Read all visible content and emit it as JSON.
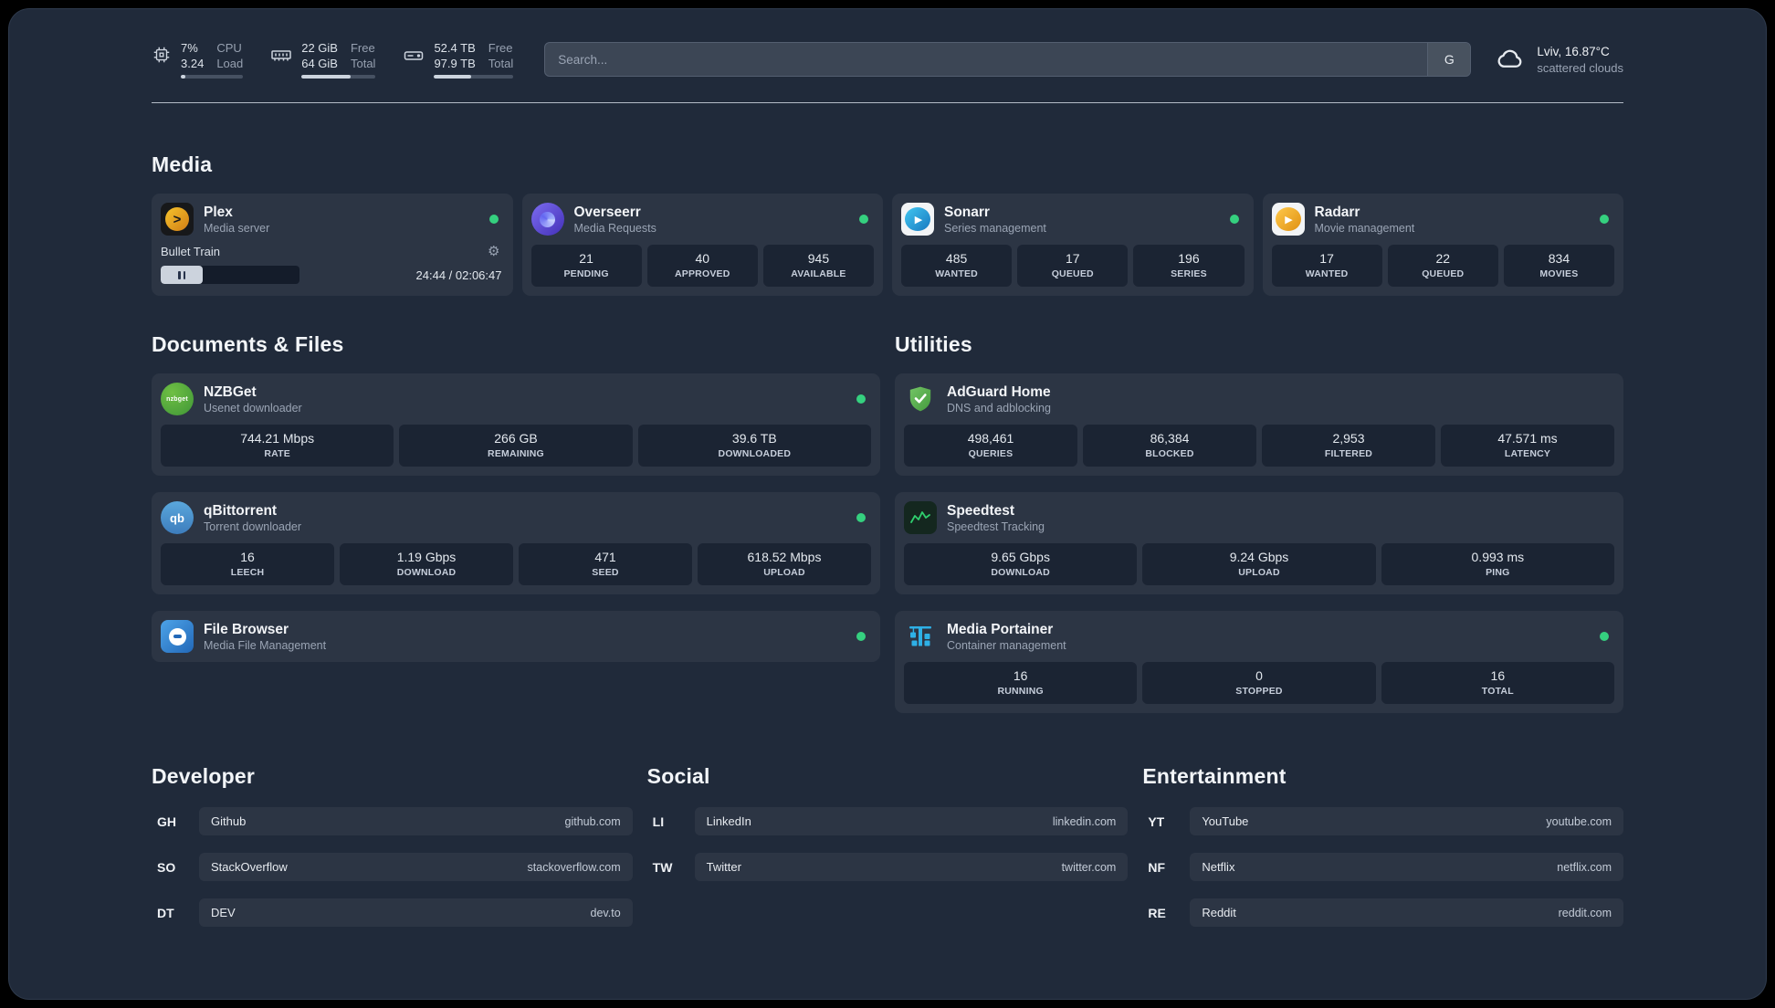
{
  "topbar": {
    "cpu": {
      "percent": "7%",
      "load": "3.24",
      "label1": "CPU",
      "label2": "Load"
    },
    "memory": {
      "value1": "22 GiB",
      "value2": "64 GiB",
      "label1": "Free",
      "label2": "Total"
    },
    "disk": {
      "value1": "52.4 TB",
      "value2": "97.9 TB",
      "label1": "Free",
      "label2": "Total"
    },
    "search": {
      "placeholder": "Search...",
      "provider": "G"
    },
    "weather": {
      "location": "Lviv, 16.87°C",
      "condition": "scattered clouds"
    }
  },
  "media": {
    "title": "Media",
    "plex": {
      "name": "Plex",
      "subtitle": "Media server",
      "now_playing": "Bullet Train",
      "time": "24:44 / 02:06:47"
    },
    "overseerr": {
      "name": "Overseerr",
      "subtitle": "Media Requests",
      "stats": [
        {
          "value": "21",
          "label": "PENDING"
        },
        {
          "value": "40",
          "label": "APPROVED"
        },
        {
          "value": "945",
          "label": "AVAILABLE"
        }
      ]
    },
    "sonarr": {
      "name": "Sonarr",
      "subtitle": "Series management",
      "stats": [
        {
          "value": "485",
          "label": "WANTED"
        },
        {
          "value": "17",
          "label": "QUEUED"
        },
        {
          "value": "196",
          "label": "SERIES"
        }
      ]
    },
    "radarr": {
      "name": "Radarr",
      "subtitle": "Movie management",
      "stats": [
        {
          "value": "17",
          "label": "WANTED"
        },
        {
          "value": "22",
          "label": "QUEUED"
        },
        {
          "value": "834",
          "label": "MOVIES"
        }
      ]
    }
  },
  "documents": {
    "title": "Documents & Files",
    "nzbget": {
      "name": "NZBGet",
      "subtitle": "Usenet downloader",
      "stats": [
        {
          "value": "744.21 Mbps",
          "label": "RATE"
        },
        {
          "value": "266 GB",
          "label": "REMAINING"
        },
        {
          "value": "39.6 TB",
          "label": "DOWNLOADED"
        }
      ]
    },
    "qbittorrent": {
      "name": "qBittorrent",
      "subtitle": "Torrent downloader",
      "stats": [
        {
          "value": "16",
          "label": "LEECH"
        },
        {
          "value": "1.19 Gbps",
          "label": "DOWNLOAD"
        },
        {
          "value": "471",
          "label": "SEED"
        },
        {
          "value": "618.52 Mbps",
          "label": "UPLOAD"
        }
      ]
    },
    "filebrowser": {
      "name": "File Browser",
      "subtitle": "Media File Management"
    }
  },
  "utilities": {
    "title": "Utilities",
    "adguard": {
      "name": "AdGuard Home",
      "subtitle": "DNS and adblocking",
      "stats": [
        {
          "value": "498,461",
          "label": "QUERIES"
        },
        {
          "value": "86,384",
          "label": "BLOCKED"
        },
        {
          "value": "2,953",
          "label": "FILTERED"
        },
        {
          "value": "47.571 ms",
          "label": "LATENCY"
        }
      ]
    },
    "speedtest": {
      "name": "Speedtest",
      "subtitle": "Speedtest Tracking",
      "stats": [
        {
          "value": "9.65 Gbps",
          "label": "DOWNLOAD"
        },
        {
          "value": "9.24 Gbps",
          "label": "UPLOAD"
        },
        {
          "value": "0.993 ms",
          "label": "PING"
        }
      ]
    },
    "portainer": {
      "name": "Media Portainer",
      "subtitle": "Container management",
      "stats": [
        {
          "value": "16",
          "label": "RUNNING"
        },
        {
          "value": "0",
          "label": "STOPPED"
        },
        {
          "value": "16",
          "label": "TOTAL"
        }
      ]
    }
  },
  "bookmarks": [
    {
      "title": "Developer",
      "items": [
        {
          "abbr": "GH",
          "name": "Github",
          "url": "github.com"
        },
        {
          "abbr": "SO",
          "name": "StackOverflow",
          "url": "stackoverflow.com"
        },
        {
          "abbr": "DT",
          "name": "DEV",
          "url": "dev.to"
        }
      ]
    },
    {
      "title": "Social",
      "items": [
        {
          "abbr": "LI",
          "name": "LinkedIn",
          "url": "linkedin.com"
        },
        {
          "abbr": "TW",
          "name": "Twitter",
          "url": "twitter.com"
        }
      ]
    },
    {
      "title": "Entertainment",
      "items": [
        {
          "abbr": "YT",
          "name": "YouTube",
          "url": "youtube.com"
        },
        {
          "abbr": "NF",
          "name": "Netflix",
          "url": "netflix.com"
        },
        {
          "abbr": "RE",
          "name": "Reddit",
          "url": "reddit.com"
        }
      ]
    }
  ],
  "icons": {
    "gear": "⚙",
    "plex_glyph": ">",
    "play": "▶",
    "nzbget_label": "nzbget",
    "qb_label": "qb"
  }
}
